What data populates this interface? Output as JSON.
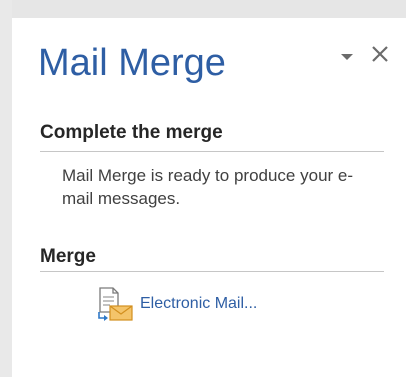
{
  "pane": {
    "title": "Mail Merge",
    "options_icon": "dropdown-triangle-icon",
    "close_icon": "close-icon"
  },
  "sections": {
    "complete": {
      "heading": "Complete the merge",
      "text": "Mail Merge is ready to produce your e-mail messages."
    },
    "merge": {
      "heading": "Merge",
      "link_label": "Electronic Mail...",
      "link_icon": "email-document-icon"
    }
  },
  "colors": {
    "title_blue": "#2e5ea4",
    "link_blue": "#2e5ea4",
    "rule_gray": "#c6c6c6",
    "envelope_gold": "#e8a93a"
  }
}
